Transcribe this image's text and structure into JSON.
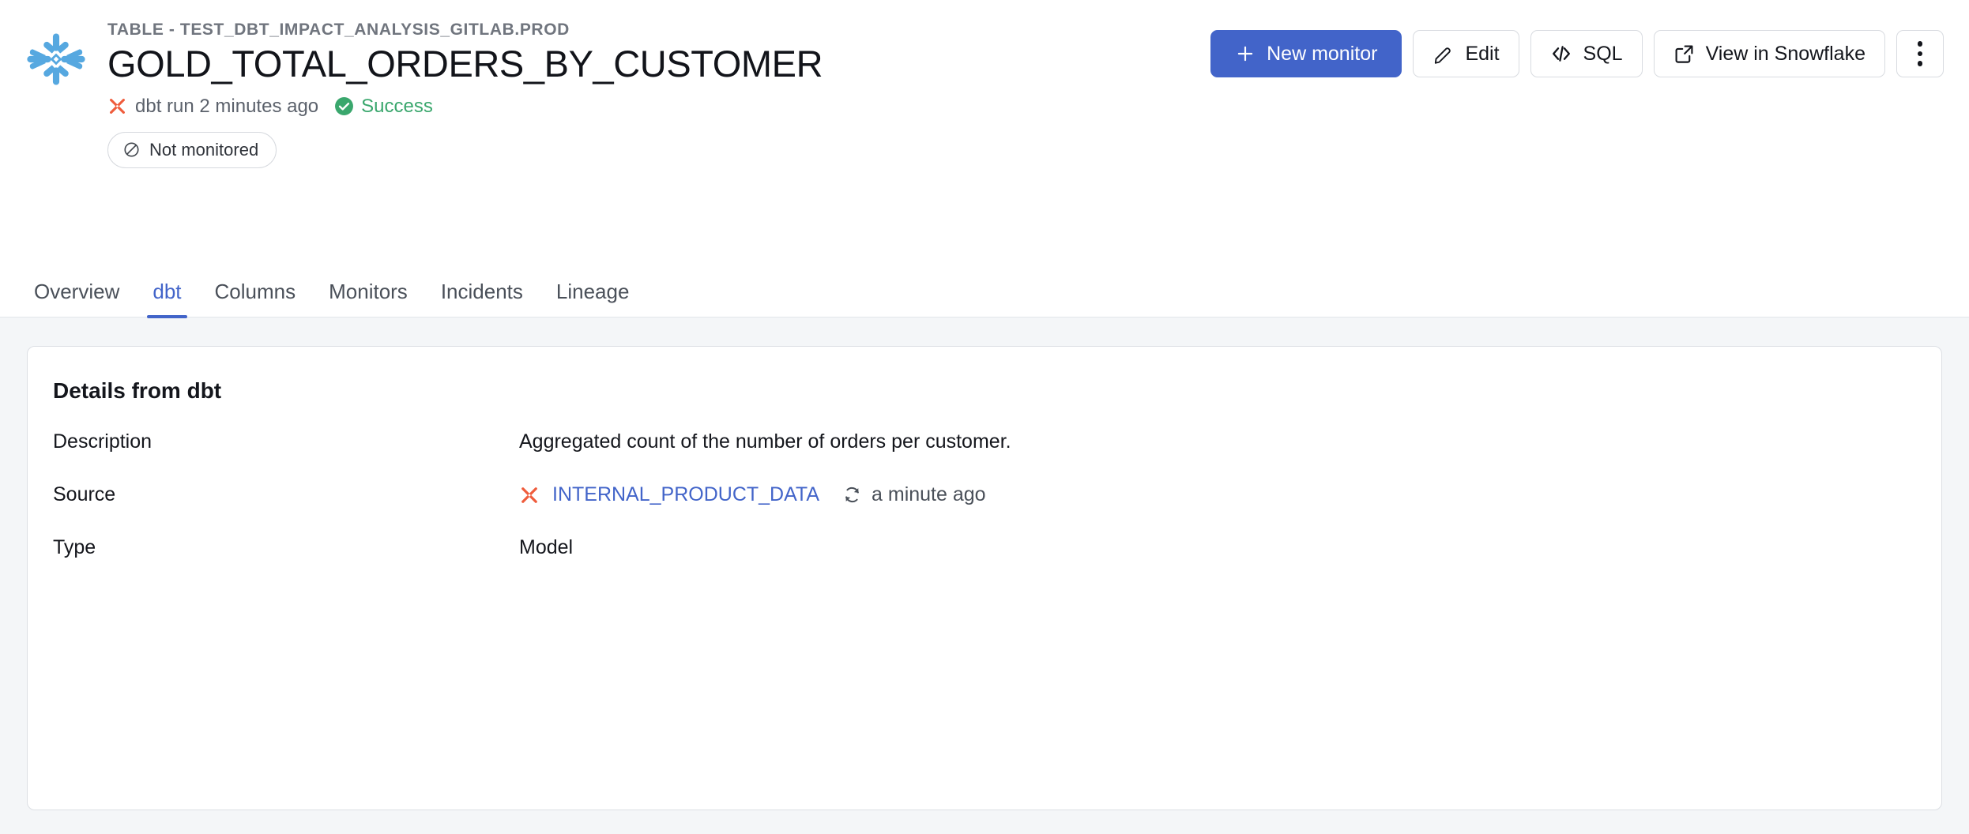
{
  "header": {
    "source_icon": "snowflake-icon",
    "breadcrumb": "TABLE - TEST_DBT_IMPACT_ANALYSIS_GITLAB.PROD",
    "title": "GOLD_TOTAL_ORDERS_BY_CUSTOMER",
    "run_icon": "dbt-icon",
    "run_status_text": "dbt run 2 minutes ago",
    "status_icon": "check-circle-icon",
    "status_label": "Success",
    "monitor_badge": {
      "icon": "no-monitor-icon",
      "label": "Not monitored"
    }
  },
  "actions": {
    "new_monitor": {
      "label": "New monitor",
      "icon": "plus-icon"
    },
    "edit": {
      "label": "Edit",
      "icon": "pencil-icon"
    },
    "sql": {
      "label": "SQL",
      "icon": "code-icon"
    },
    "view_in_snowflake": {
      "label": "View in Snowflake",
      "icon": "external-link-icon"
    },
    "more": {
      "label": "",
      "icon": "kebab-menu-icon"
    }
  },
  "tabs": [
    {
      "label": "Overview",
      "active": false
    },
    {
      "label": "dbt",
      "active": true
    },
    {
      "label": "Columns",
      "active": false
    },
    {
      "label": "Monitors",
      "active": false
    },
    {
      "label": "Incidents",
      "active": false
    },
    {
      "label": "Lineage",
      "active": false
    }
  ],
  "card": {
    "title": "Details from dbt",
    "rows": [
      {
        "label": "Description",
        "value": "Aggregated count of the number of orders per customer."
      },
      {
        "label": "Source",
        "value": "INTERNAL_PRODUCT_DATA",
        "sync_text": "a minute ago"
      },
      {
        "label": "Type",
        "value": "Model"
      }
    ]
  },
  "colors": {
    "accent_blue": "#4264c9",
    "snowflake_blue": "#56a8e0",
    "dbt_orange": "#ef5c3c",
    "success_green": "#3aa76d",
    "page_bg": "#f4f6f8"
  }
}
